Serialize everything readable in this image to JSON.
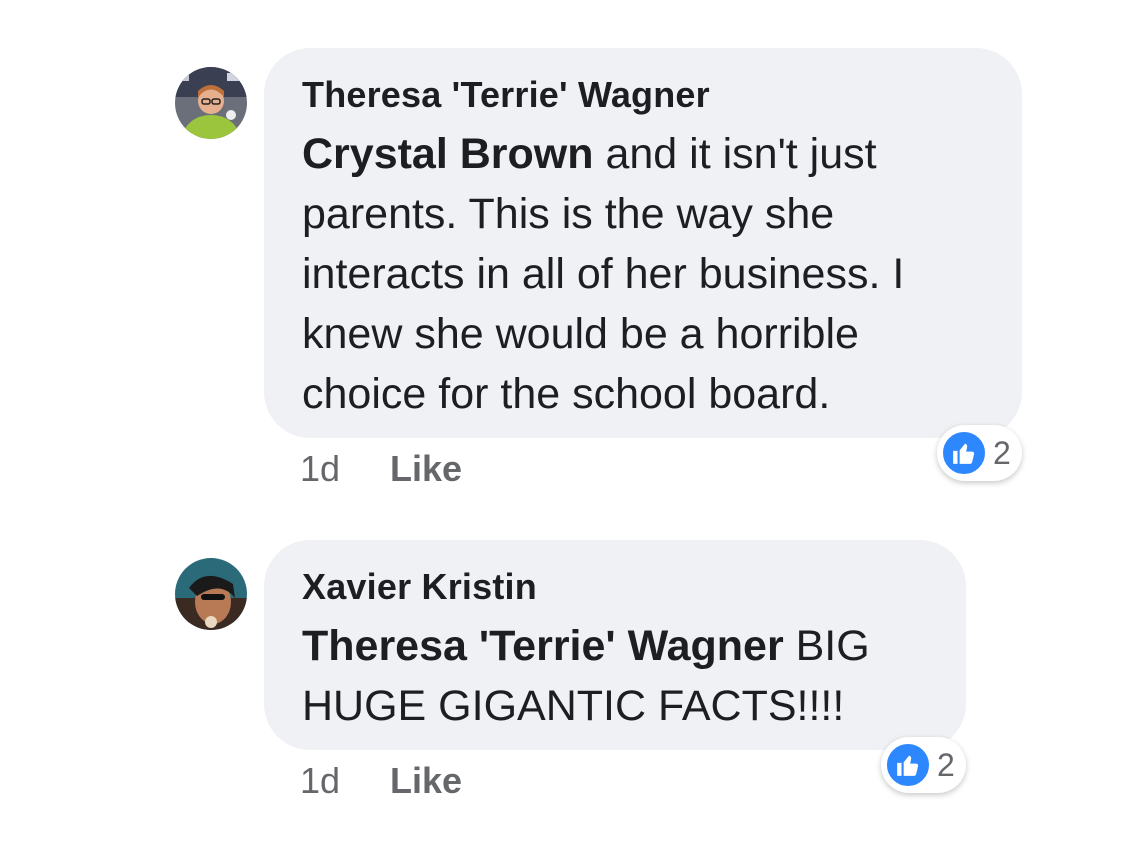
{
  "comments": [
    {
      "author": "Theresa 'Terrie' Wagner",
      "mention": "Crystal Brown",
      "text": " and it isn't just parents. This is the way she interacts in all of her business. I knew she would be a horrible choice for the school board.",
      "time": "1d",
      "like_label": "Like",
      "reaction_icon": "thumbs-up-icon",
      "reaction_count": "2"
    },
    {
      "author": "Xavier Kristin",
      "mention": "Theresa 'Terrie' Wagner",
      "text": " BIG HUGE GIGANTIC FACTS!!!!",
      "time": "1d",
      "like_label": "Like",
      "reaction_icon": "thumbs-up-icon",
      "reaction_count": "2"
    }
  ],
  "colors": {
    "bubble": "#f0f1f4",
    "text": "#1c1e21",
    "meta": "#65676b",
    "like_badge": "#2d88ff"
  }
}
